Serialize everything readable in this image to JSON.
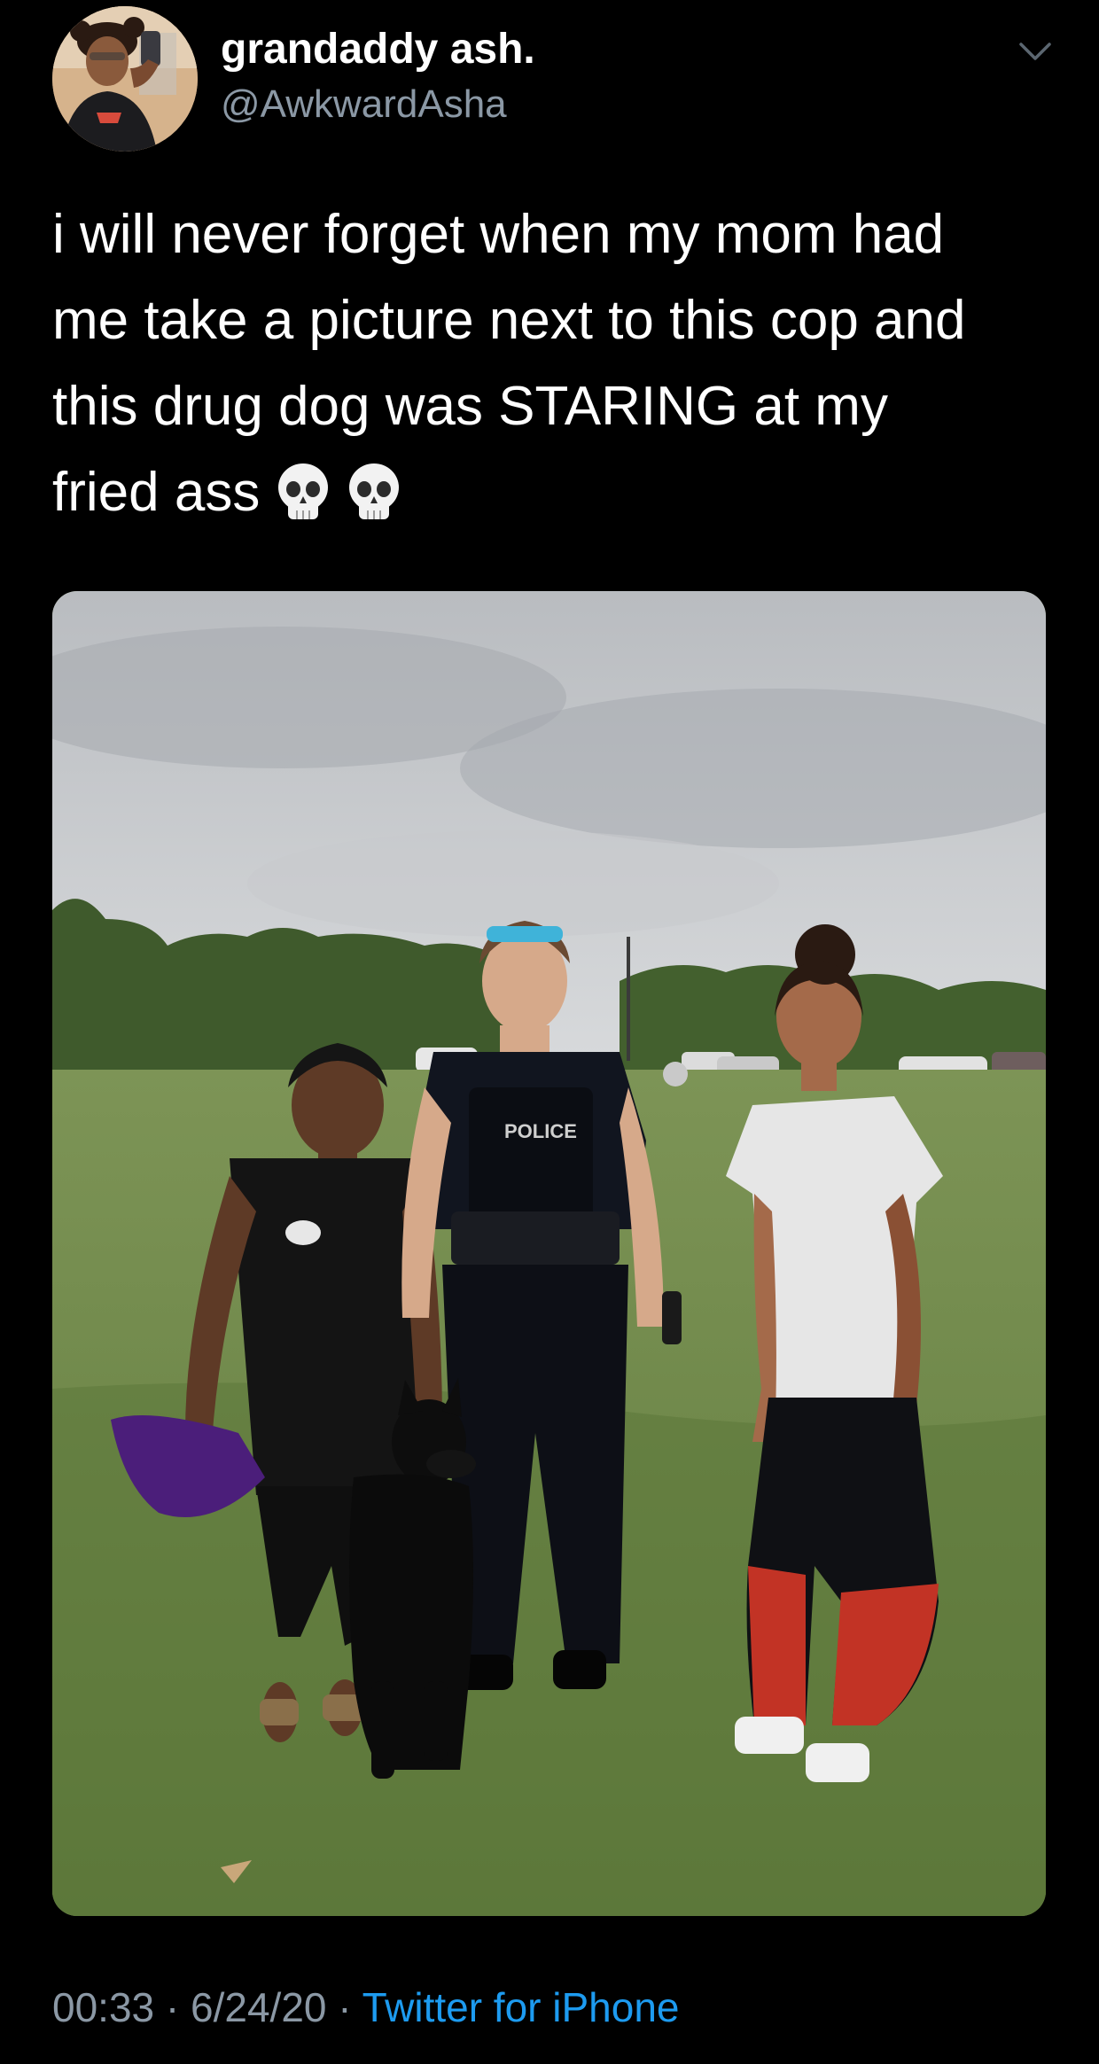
{
  "user": {
    "display_name": "grandaddy ash.",
    "handle": "@AwkwardAsha"
  },
  "tweet": {
    "text_lines": [
      "i will never forget when my mom had",
      "me take a picture next to this cop and",
      "this drug dog was STARING at my",
      "fried ass"
    ],
    "emoji": [
      "skull-emoji",
      "skull-emoji"
    ]
  },
  "media": {
    "vest_label": "POLICE"
  },
  "footer": {
    "time": "00:33",
    "separator": " · ",
    "date": "6/24/20",
    "source": "Twitter for iPhone"
  },
  "colors": {
    "background": "#000000",
    "text_primary": "#ffffff",
    "text_secondary": "#8b98a5",
    "link": "#1d9bf0"
  },
  "icons": [
    "avatar-photo",
    "chevron-down-icon",
    "skull-emoji"
  ]
}
